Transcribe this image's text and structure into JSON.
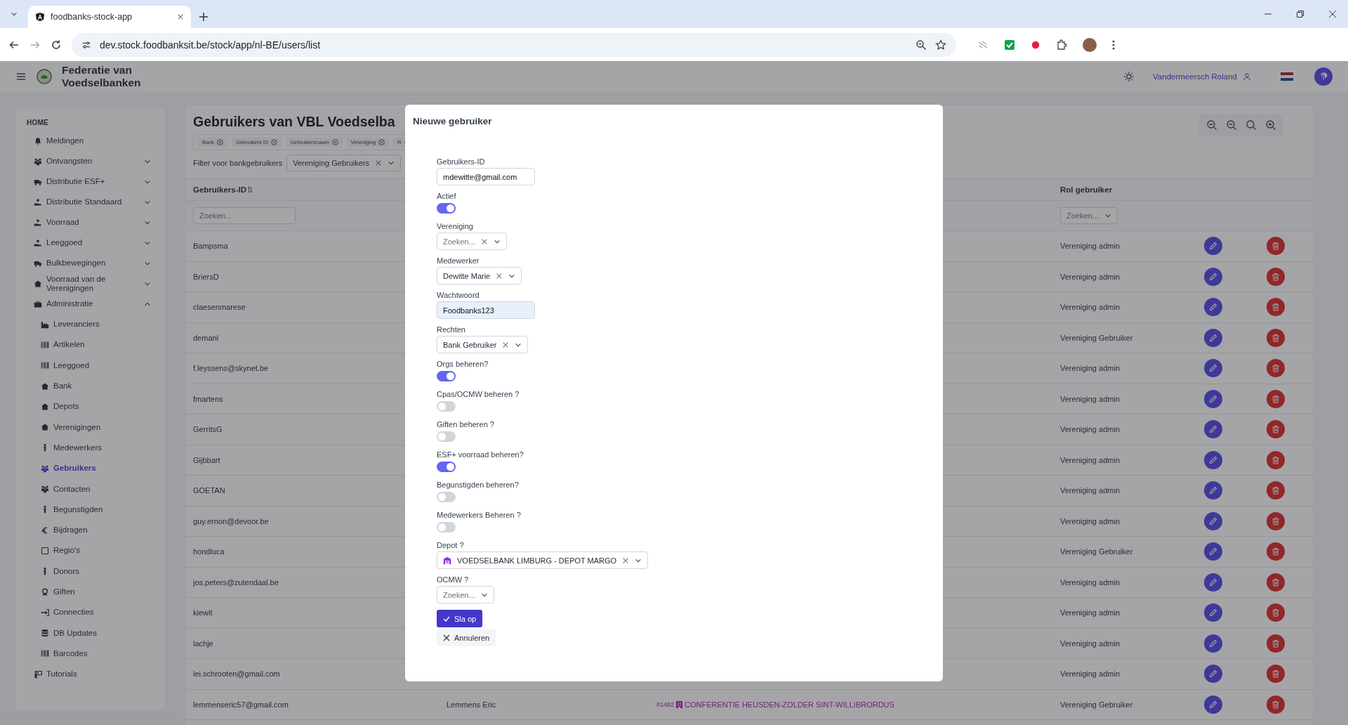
{
  "browser": {
    "tab_title": "foodbanks-stock-app",
    "url": "dev.stock.foodbanksit.be/stock/app/nl-BE/users/list"
  },
  "app_header": {
    "title": "Federatie van Voedselbanken",
    "user_name": "Vandermeersch Roland"
  },
  "sidebar": {
    "heading": "HOME",
    "items": [
      {
        "label": "Meldingen",
        "kind": "link",
        "selected": false
      },
      {
        "label": "Ontvangsten",
        "kind": "group",
        "expanded": false,
        "selected": false
      },
      {
        "label": "Distributie ESF+",
        "kind": "group",
        "expanded": false,
        "selected": false
      },
      {
        "label": "Distributie Standaard",
        "kind": "group",
        "expanded": false,
        "selected": false
      },
      {
        "label": "Voorraad",
        "kind": "group",
        "expanded": false,
        "selected": false
      },
      {
        "label": "Leeggoed",
        "kind": "group",
        "expanded": false,
        "selected": false
      },
      {
        "label": "Bulkbewegingen",
        "kind": "group",
        "expanded": false,
        "selected": false
      },
      {
        "label": "Voorraad van de Verenigingen",
        "kind": "group",
        "expanded": false,
        "selected": false
      },
      {
        "label": "Administratie",
        "kind": "group",
        "expanded": true,
        "selected": false,
        "children": [
          {
            "label": "Leveranciers",
            "selected": false
          },
          {
            "label": "Artikelen",
            "selected": false
          },
          {
            "label": "Leeggoed",
            "selected": false
          },
          {
            "label": "Bank",
            "selected": false
          },
          {
            "label": "Depots",
            "selected": false
          },
          {
            "label": "Verenigingen",
            "selected": false
          },
          {
            "label": "Medewerkers",
            "selected": false
          },
          {
            "label": "Gebruikers",
            "selected": true
          },
          {
            "label": "Contacten",
            "selected": false
          },
          {
            "label": "Begunstigden",
            "selected": false
          },
          {
            "label": "Bijdragen",
            "selected": false
          },
          {
            "label": "Regio's",
            "selected": false
          },
          {
            "label": "Donors",
            "selected": false
          },
          {
            "label": "Giften",
            "selected": false
          },
          {
            "label": "Connecties",
            "selected": false
          },
          {
            "label": "DB Updates",
            "selected": false
          },
          {
            "label": "Barcodes",
            "selected": false
          }
        ]
      },
      {
        "label": "Tutorials",
        "kind": "link",
        "selected": false
      }
    ]
  },
  "main": {
    "title": "Gebruikers van VBL Voedselba",
    "column_chips": [
      "Bank",
      "Gebruikers ID",
      "Gebruikersnaam",
      "Vereniging",
      "R"
    ],
    "filter": {
      "label": "Filter voor bankgebruikers",
      "value": "Vereniging Gebruikers"
    },
    "table": {
      "columns": [
        {
          "label": "Gebruikers-ID",
          "placeholder": "Zoeken..."
        },
        {
          "label": "Rol gebruiker",
          "placeholder": "Zoeken..."
        }
      ],
      "rows": [
        {
          "user_id": "Bampsma",
          "role": "Vereniging admin"
        },
        {
          "user_id": "BriersD",
          "role": "Vereniging admin"
        },
        {
          "user_id": "claesenmarese",
          "role": "Vereniging admin"
        },
        {
          "user_id": "demanl",
          "role": "Vereniging Gebruiker"
        },
        {
          "user_id": "f.leyssens@skynet.be",
          "role": "Vereniging admin"
        },
        {
          "user_id": "fmartens",
          "role": "Vereniging admin"
        },
        {
          "user_id": "GerritsG",
          "role": "Vereniging admin"
        },
        {
          "user_id": "Gijbbart",
          "role": "Vereniging admin"
        },
        {
          "user_id": "GOETAN",
          "role": "Vereniging admin"
        },
        {
          "user_id": "guy.ernon@devoor.be",
          "role": "Vereniging admin"
        },
        {
          "user_id": "hondluca",
          "role": "Vereniging Gebruiker"
        },
        {
          "user_id": "jos.peters@zutendaal.be",
          "role": "Vereniging admin"
        },
        {
          "user_id": "kiewit",
          "role": "Vereniging admin"
        },
        {
          "user_id": "lachje",
          "role": "Vereniging admin"
        },
        {
          "user_id": "lei.schrooten@gmail.com",
          "role": "Vereniging admin"
        },
        {
          "user_id": "lemmenseric57@gmail.com",
          "name": "Lemmens Eric",
          "org_number": "#1482",
          "org_name": "CONFERENTIE HEUSDEN-ZOLDER SINT-WILLIBRORDUS",
          "role": "Vereniging Gebruiker"
        }
      ]
    }
  },
  "dialog": {
    "title": "Nieuwe gebruiker",
    "fields": [
      {
        "kind": "text",
        "label": "Gebruikers-ID",
        "value": "mdewitte@gmail.com",
        "autofilled": false
      },
      {
        "kind": "toggle",
        "label": "Actief",
        "on": true
      },
      {
        "kind": "select",
        "label": "Vereniging",
        "placeholder": "Zoeken...",
        "clearable": true
      },
      {
        "kind": "select",
        "label": "Medewerker",
        "value": "Dewitte Marie",
        "clearable": true
      },
      {
        "kind": "text",
        "label": "Wachtwoord",
        "value": "Foodbanks123",
        "autofilled": true
      },
      {
        "kind": "select",
        "label": "Rechten",
        "value": "Bank Gebruiker",
        "clearable": true
      },
      {
        "kind": "toggle",
        "label": "Orgs beheren?",
        "on": true
      },
      {
        "kind": "toggle",
        "label": "Cpas/OCMW beheren ?",
        "on": false
      },
      {
        "kind": "toggle",
        "label": "Giften beheren ?",
        "on": false
      },
      {
        "kind": "toggle",
        "label": "ESF+ voorraad beheren?",
        "on": true
      },
      {
        "kind": "toggle",
        "label": "Begunstigden beheren?",
        "on": false
      },
      {
        "kind": "toggle",
        "label": "Medewerkers Beheren ?",
        "on": false
      },
      {
        "kind": "depot",
        "label": "Depot ?",
        "value": "VOEDSELBANK LIMBURG - DEPOT MARGO",
        "clearable": true
      },
      {
        "kind": "select",
        "label": "OCMW ?",
        "placeholder": "Zoeken...",
        "clearable": false
      }
    ],
    "buttons": [
      {
        "kind": "primary",
        "label": "Sla op"
      },
      {
        "kind": "secondary",
        "label": "Annuleren"
      }
    ]
  }
}
